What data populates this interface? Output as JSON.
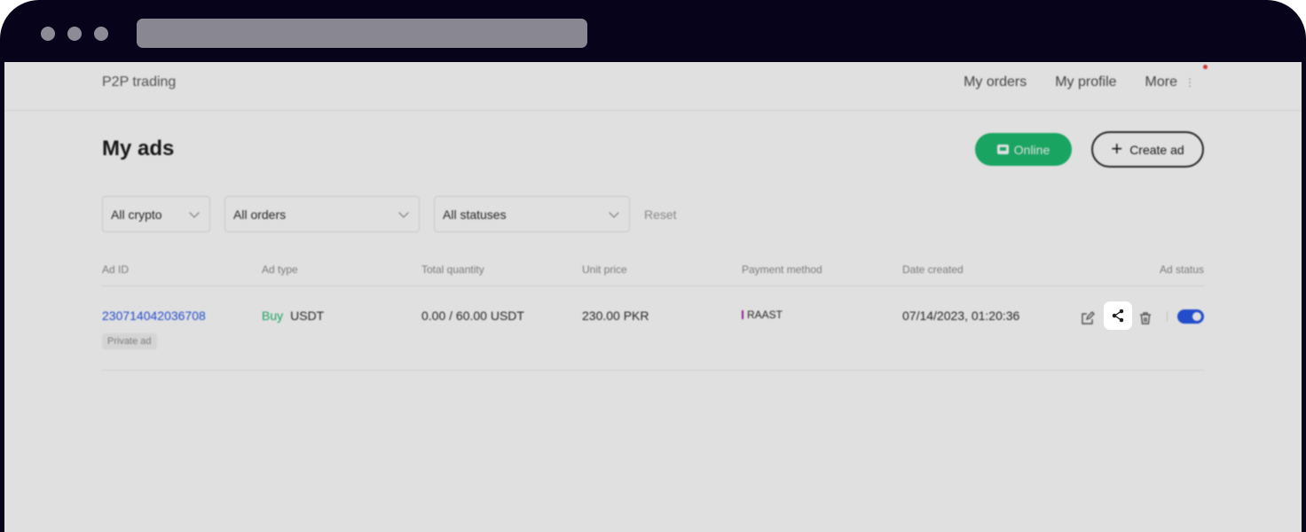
{
  "nav": {
    "brand": "P2P trading",
    "my_orders": "My orders",
    "my_profile": "My profile",
    "more": "More"
  },
  "page": {
    "title": "My ads",
    "online_label": "Online",
    "create_label": "Create ad"
  },
  "filters": {
    "crypto": "All crypto",
    "orders": "All orders",
    "statuses": "All statuses",
    "reset": "Reset"
  },
  "table": {
    "headers": [
      "Ad ID",
      "Ad type",
      "Total quantity",
      "Unit price",
      "Payment method",
      "Date created",
      "Ad status"
    ],
    "rows": [
      {
        "ad_id": "230714042036708",
        "tag": "Private ad",
        "side": "Buy",
        "asset": "USDT",
        "quantity": "0.00 / 60.00 USDT",
        "price": "230.00 PKR",
        "payment": "RAAST",
        "date": "07/14/2023, 01:20:36",
        "active": true
      }
    ]
  },
  "colors": {
    "accent_green": "#13b869",
    "link_blue": "#1e50e6",
    "frame": "#06031a"
  },
  "icons": {
    "edit": "edit-icon",
    "share": "share-icon",
    "delete": "trash-icon"
  }
}
